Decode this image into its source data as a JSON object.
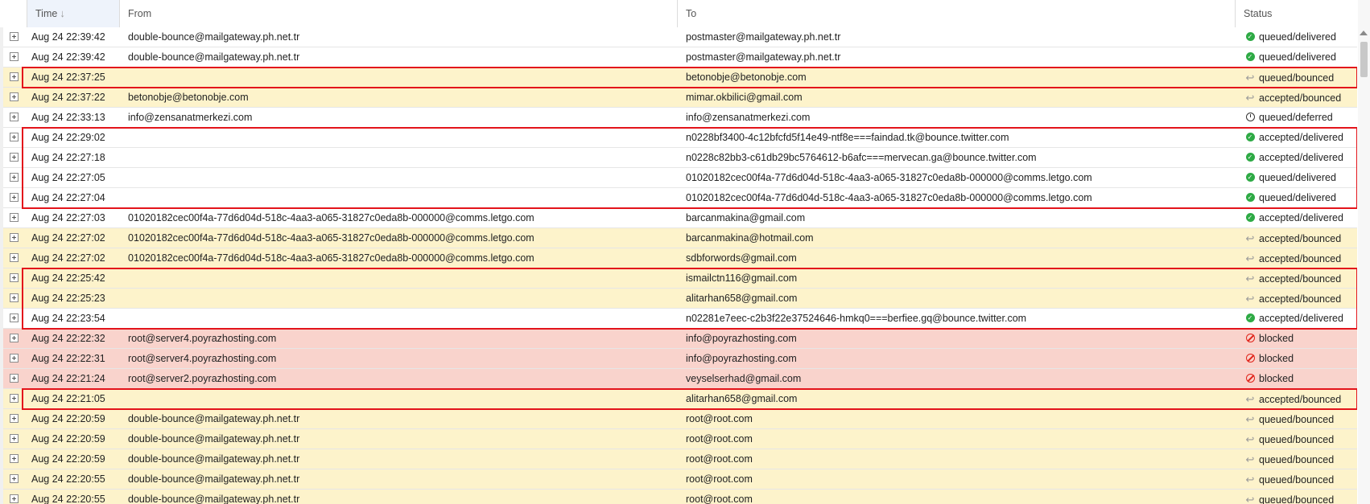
{
  "columns": {
    "time": "Time",
    "from": "From",
    "to": "To",
    "status": "Status",
    "sort_icon": "arrow-down-icon"
  },
  "colors": {
    "highlight_border": "#e3141b",
    "row_yellow": "#fdf3cb",
    "row_red": "#f9d3cc",
    "delivered_icon": "#2eaa45",
    "blocked_icon": "#e0241b"
  },
  "rows": [
    {
      "time": "Aug 24 22:39:42",
      "from": "double-bounce@mailgateway.ph.net.tr",
      "to": "postmaster@mailgateway.ph.net.tr",
      "status": "queued/delivered",
      "icon": "check-circle-icon",
      "bg": "white"
    },
    {
      "time": "Aug 24 22:39:42",
      "from": "double-bounce@mailgateway.ph.net.tr",
      "to": "postmaster@mailgateway.ph.net.tr",
      "status": "queued/delivered",
      "icon": "check-circle-icon",
      "bg": "white"
    },
    {
      "time": "Aug 24 22:37:25",
      "from": "",
      "to": "betonobje@betonobje.com",
      "status": "queued/bounced",
      "icon": "bounce-arrow-icon",
      "bg": "yellow"
    },
    {
      "time": "Aug 24 22:37:22",
      "from": "betonobje@betonobje.com",
      "to": "mimar.okbilici@gmail.com",
      "status": "accepted/bounced",
      "icon": "bounce-arrow-icon",
      "bg": "yellow"
    },
    {
      "time": "Aug 24 22:33:13",
      "from": "info@zensanatmerkezi.com",
      "to": "info@zensanatmerkezi.com",
      "status": "queued/deferred",
      "icon": "clock-icon",
      "bg": "white"
    },
    {
      "time": "Aug 24 22:29:02",
      "from": "",
      "to": "n0228bf3400-4c12bfcfd5f14e49-ntf8e===faindad.tk@bounce.twitter.com",
      "status": "accepted/delivered",
      "icon": "check-circle-icon",
      "bg": "white"
    },
    {
      "time": "Aug 24 22:27:18",
      "from": "",
      "to": "n0228c82bb3-c61db29bc5764612-b6afc===mervecan.ga@bounce.twitter.com",
      "status": "accepted/delivered",
      "icon": "check-circle-icon",
      "bg": "white"
    },
    {
      "time": "Aug 24 22:27:05",
      "from": "",
      "to": "01020182cec00f4a-77d6d04d-518c-4aa3-a065-31827c0eda8b-000000@comms.letgo.com",
      "status": "queued/delivered",
      "icon": "check-circle-icon",
      "bg": "white"
    },
    {
      "time": "Aug 24 22:27:04",
      "from": "",
      "to": "01020182cec00f4a-77d6d04d-518c-4aa3-a065-31827c0eda8b-000000@comms.letgo.com",
      "status": "queued/delivered",
      "icon": "check-circle-icon",
      "bg": "white"
    },
    {
      "time": "Aug 24 22:27:03",
      "from": "01020182cec00f4a-77d6d04d-518c-4aa3-a065-31827c0eda8b-000000@comms.letgo.com",
      "to": "barcanmakina@gmail.com",
      "status": "accepted/delivered",
      "icon": "check-circle-icon",
      "bg": "white"
    },
    {
      "time": "Aug 24 22:27:02",
      "from": "01020182cec00f4a-77d6d04d-518c-4aa3-a065-31827c0eda8b-000000@comms.letgo.com",
      "to": "barcanmakina@hotmail.com",
      "status": "accepted/bounced",
      "icon": "bounce-arrow-icon",
      "bg": "yellow"
    },
    {
      "time": "Aug 24 22:27:02",
      "from": "01020182cec00f4a-77d6d04d-518c-4aa3-a065-31827c0eda8b-000000@comms.letgo.com",
      "to": "sdbforwords@gmail.com",
      "status": "accepted/bounced",
      "icon": "bounce-arrow-icon",
      "bg": "yellow"
    },
    {
      "time": "Aug 24 22:25:42",
      "from": "",
      "to": "ismailctn116@gmail.com",
      "status": "accepted/bounced",
      "icon": "bounce-arrow-icon",
      "bg": "yellow"
    },
    {
      "time": "Aug 24 22:25:23",
      "from": "",
      "to": "alitarhan658@gmail.com",
      "status": "accepted/bounced",
      "icon": "bounce-arrow-icon",
      "bg": "yellow"
    },
    {
      "time": "Aug 24 22:23:54",
      "from": "",
      "to": "n02281e7eec-c2b3f22e37524646-hmkq0===berfiee.gq@bounce.twitter.com",
      "status": "accepted/delivered",
      "icon": "check-circle-icon",
      "bg": "white"
    },
    {
      "time": "Aug 24 22:22:32",
      "from": "root@server4.poyrazhosting.com",
      "to": "info@poyrazhosting.com",
      "status": "blocked",
      "icon": "blocked-icon",
      "bg": "red"
    },
    {
      "time": "Aug 24 22:22:31",
      "from": "root@server4.poyrazhosting.com",
      "to": "info@poyrazhosting.com",
      "status": "blocked",
      "icon": "blocked-icon",
      "bg": "red"
    },
    {
      "time": "Aug 24 22:21:24",
      "from": "root@server2.poyrazhosting.com",
      "to": "veyselserhad@gmail.com",
      "status": "blocked",
      "icon": "blocked-icon",
      "bg": "red"
    },
    {
      "time": "Aug 24 22:21:05",
      "from": "",
      "to": "alitarhan658@gmail.com",
      "status": "accepted/bounced",
      "icon": "bounce-arrow-icon",
      "bg": "yellow"
    },
    {
      "time": "Aug 24 22:20:59",
      "from": "double-bounce@mailgateway.ph.net.tr",
      "to": "root@root.com",
      "status": "queued/bounced",
      "icon": "bounce-arrow-icon",
      "bg": "yellow"
    },
    {
      "time": "Aug 24 22:20:59",
      "from": "double-bounce@mailgateway.ph.net.tr",
      "to": "root@root.com",
      "status": "queued/bounced",
      "icon": "bounce-arrow-icon",
      "bg": "yellow"
    },
    {
      "time": "Aug 24 22:20:59",
      "from": "double-bounce@mailgateway.ph.net.tr",
      "to": "root@root.com",
      "status": "queued/bounced",
      "icon": "bounce-arrow-icon",
      "bg": "yellow"
    },
    {
      "time": "Aug 24 22:20:55",
      "from": "double-bounce@mailgateway.ph.net.tr",
      "to": "root@root.com",
      "status": "queued/bounced",
      "icon": "bounce-arrow-icon",
      "bg": "yellow"
    },
    {
      "time": "Aug 24 22:20:55",
      "from": "double-bounce@mailgateway.ph.net.tr",
      "to": "root@root.com",
      "status": "queued/bounced",
      "icon": "bounce-arrow-icon",
      "bg": "yellow"
    }
  ],
  "highlight_groups": [
    {
      "first_row": 2,
      "last_row": 2
    },
    {
      "first_row": 5,
      "last_row": 8
    },
    {
      "first_row": 12,
      "last_row": 14
    },
    {
      "first_row": 18,
      "last_row": 18
    }
  ]
}
